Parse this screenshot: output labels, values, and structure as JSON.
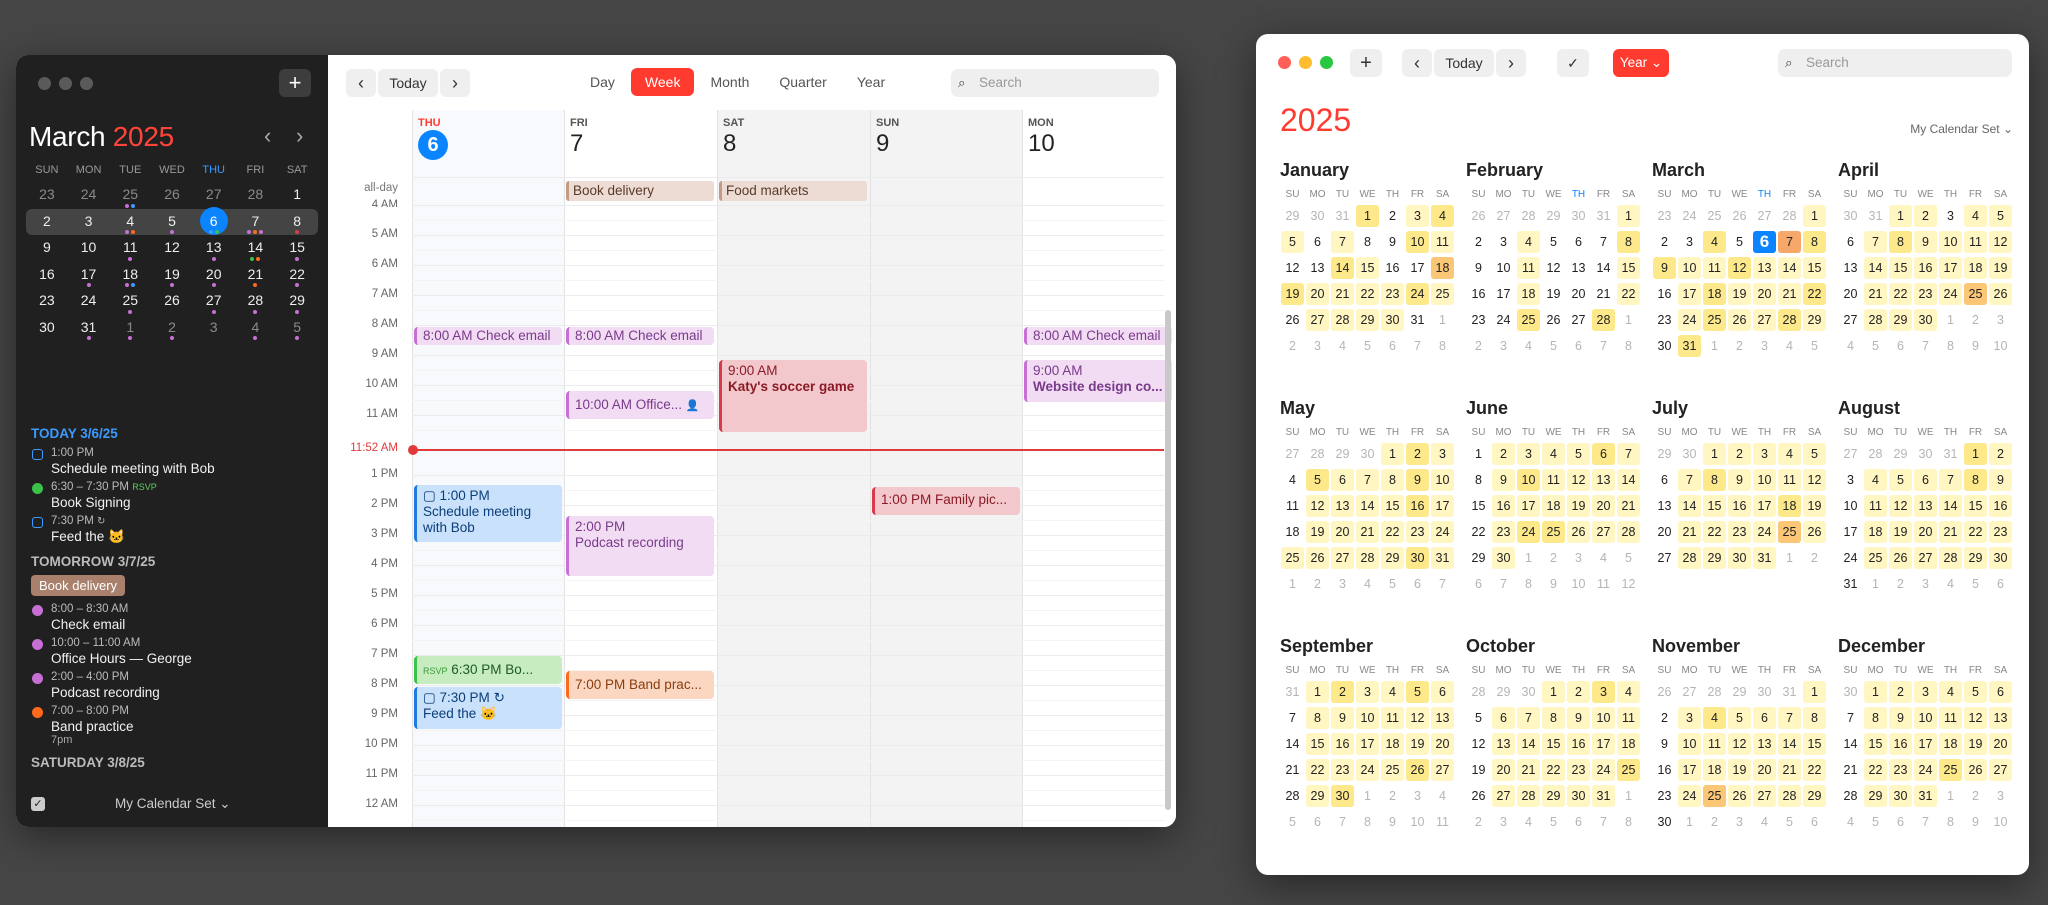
{
  "colors": {
    "accent_red": "#ff3b30",
    "today_blue": "#0a84ff"
  },
  "win1": {
    "add_label": "+",
    "mini": {
      "month": "March",
      "year": "2025",
      "prev": "‹",
      "next": "›",
      "weekdays": [
        "SUN",
        "MON",
        "TUE",
        "WED",
        "THU",
        "FRI",
        "SAT"
      ],
      "weeks": [
        [
          "23",
          "24",
          "25",
          "26",
          "27",
          "28",
          "1"
        ],
        [
          "2",
          "3",
          "4",
          "5",
          "6",
          "7",
          "8"
        ],
        [
          "9",
          "10",
          "11",
          "12",
          "13",
          "14",
          "15"
        ],
        [
          "16",
          "17",
          "18",
          "19",
          "20",
          "21",
          "22"
        ],
        [
          "23",
          "24",
          "25",
          "26",
          "27",
          "28",
          "29"
        ],
        [
          "30",
          "31",
          "1",
          "2",
          "3",
          "4",
          "5"
        ]
      ]
    },
    "agenda": {
      "today_head": "TODAY 3/6/25",
      "today_items": [
        {
          "time": "1:00 PM",
          "title": "Schedule meeting with Bob"
        },
        {
          "time": "6:30 – 7:30 PM",
          "rsvp": "RSVP",
          "title": "Book Signing"
        },
        {
          "time": "7:30 PM",
          "title": "Feed the 🐱"
        }
      ],
      "tomorrow_head": "TOMORROW 3/7/25",
      "tomorrow_allday": "Book delivery",
      "tomorrow_items": [
        {
          "time": "8:00 – 8:30 AM",
          "title": "Check email"
        },
        {
          "time": "10:00 – 11:00 AM",
          "title": "Office Hours — George"
        },
        {
          "time": "2:00 – 4:00 PM",
          "title": "Podcast recording"
        },
        {
          "time": "7:00 – 8:00 PM",
          "title": "Band practice",
          "sub": "7pm"
        }
      ],
      "saturday_head": "SATURDAY 3/8/25"
    },
    "bottom": {
      "calset": "My Calendar Set ⌄"
    },
    "toolbar": {
      "prev": "‹",
      "today": "Today",
      "next": "›",
      "views": [
        "Day",
        "Week",
        "Month",
        "Quarter",
        "Year"
      ],
      "search_placeholder": "Search"
    },
    "days": [
      {
        "name": "THU",
        "num": "6"
      },
      {
        "name": "FRI",
        "num": "7"
      },
      {
        "name": "SAT",
        "num": "8"
      },
      {
        "name": "SUN",
        "num": "9"
      },
      {
        "name": "MON",
        "num": "10"
      }
    ],
    "allday_label": "all-day",
    "allday_events": [
      "Book delivery",
      "Food markets"
    ],
    "hours": [
      "4 AM",
      "5 AM",
      "6 AM",
      "7 AM",
      "8 AM",
      "9 AM",
      "10 AM",
      "11 AM",
      "1 PM",
      "2 PM",
      "3 PM",
      "4 PM",
      "5 PM",
      "6 PM",
      "7 PM",
      "8 PM",
      "9 PM",
      "10 PM",
      "11 PM",
      "12 AM"
    ],
    "now_label": "11:52 AM",
    "events": {
      "thu_email": "8:00 AM Check email",
      "fri_email": "8:00 AM Check email",
      "mon_email": "8:00 AM Check email",
      "fri_office": "10:00 AM Office...",
      "sat_soccer_time": "9:00 AM",
      "sat_soccer_title": "Katy's soccer game",
      "mon_web_time": "9:00 AM",
      "mon_web_title": "Website design co...",
      "thu_bob_time": "1:00 PM",
      "thu_bob_title": "Schedule meeting with Bob",
      "sun_family": "1:00 PM Family pic...",
      "fri_pod_time": "2:00 PM",
      "fri_pod_title": "Podcast recording",
      "thu_book_rsvp": "RSVP",
      "thu_book": "6:30 PM Bo...",
      "fri_band": "7:00 PM Band prac...",
      "thu_feed_time": "7:30 PM",
      "thu_feed_title": "Feed the 🐱"
    }
  },
  "win2": {
    "toolbar": {
      "add": "+",
      "prev": "‹",
      "today": "Today",
      "next": "›",
      "check": "✓",
      "view": "Year ⌄",
      "search_placeholder": "Search"
    },
    "year": "2025",
    "calset": "My Calendar Set ⌄",
    "weekdays": [
      "SU",
      "MO",
      "TU",
      "WE",
      "TH",
      "FR",
      "SA"
    ],
    "months": [
      {
        "name": "January",
        "lead": [
          "29",
          "30",
          "31"
        ],
        "days": 31,
        "trail": [
          "1",
          "2",
          "3",
          "4",
          "5",
          "6",
          "7",
          "8"
        ],
        "hl": {
          "1": 2,
          "3": 1,
          "4": 2,
          "5": 1,
          "7": 1,
          "10": 2,
          "11": 1,
          "14": 2,
          "15": 1,
          "18": 3,
          "19": 2,
          "20": 1,
          "21": 1,
          "22": 1,
          "23": 1,
          "24": 2,
          "25": 1,
          "27": 1,
          "28": 1,
          "29": 1,
          "30": 1
        }
      },
      {
        "name": "February",
        "lead": [
          "26",
          "27",
          "28",
          "29",
          "30",
          "31"
        ],
        "days": 28,
        "trail": [
          "1",
          "2",
          "3",
          "4",
          "5",
          "6",
          "7",
          "8"
        ],
        "hl": {
          "1": 1,
          "4": 1,
          "8": 2,
          "11": 1,
          "15": 1,
          "18": 1,
          "22": 1,
          "25": 2,
          "28": 2
        }
      },
      {
        "name": "March",
        "lead": [
          "23",
          "24",
          "25",
          "26",
          "27",
          "28"
        ],
        "days": 31,
        "trail": [
          "1",
          "2",
          "3",
          "4",
          "5"
        ],
        "hl": {
          "1": 1,
          "4": 2,
          "6": 5,
          "7": 4,
          "8": 2,
          "9": 2,
          "10": 1,
          "11": 1,
          "12": 2,
          "13": 1,
          "14": 1,
          "15": 1,
          "17": 1,
          "18": 2,
          "19": 1,
          "20": 1,
          "21": 1,
          "22": 2,
          "24": 1,
          "25": 2,
          "26": 1,
          "27": 1,
          "28": 2,
          "29": 1,
          "31": 2
        }
      },
      {
        "name": "April",
        "lead": [
          "30",
          "31"
        ],
        "days": 30,
        "trail": [
          "1",
          "2",
          "3",
          "4",
          "5",
          "6",
          "7",
          "8",
          "9",
          "10"
        ],
        "hl": {
          "1": 1,
          "2": 1,
          "4": 1,
          "5": 1,
          "7": 1,
          "8": 2,
          "9": 1,
          "10": 1,
          "11": 1,
          "12": 1,
          "14": 1,
          "15": 1,
          "16": 1,
          "17": 1,
          "18": 1,
          "19": 1,
          "21": 1,
          "22": 1,
          "23": 1,
          "24": 1,
          "25": 3,
          "26": 1,
          "28": 1,
          "29": 1,
          "30": 1
        }
      },
      {
        "name": "May",
        "lead": [
          "27",
          "28",
          "29",
          "30"
        ],
        "days": 31,
        "trail": [
          "1",
          "2",
          "3",
          "4",
          "5",
          "6",
          "7"
        ],
        "hl": {
          "1": 1,
          "2": 2,
          "3": 1,
          "5": 2,
          "6": 1,
          "7": 1,
          "8": 1,
          "9": 2,
          "10": 1,
          "12": 1,
          "13": 1,
          "14": 1,
          "15": 1,
          "16": 2,
          "17": 1,
          "19": 1,
          "20": 1,
          "21": 1,
          "22": 1,
          "23": 1,
          "24": 1,
          "25": 1,
          "26": 1,
          "27": 1,
          "28": 1,
          "29": 1,
          "30": 2,
          "31": 1
        }
      },
      {
        "name": "June",
        "lead": [],
        "days": 30,
        "trail": [
          "1",
          "2",
          "3",
          "4",
          "5",
          "6",
          "7",
          "8",
          "9",
          "10",
          "11",
          "12"
        ],
        "hl": {
          "2": 1,
          "3": 1,
          "4": 1,
          "5": 1,
          "6": 2,
          "7": 1,
          "9": 1,
          "10": 2,
          "11": 1,
          "12": 1,
          "13": 1,
          "14": 1,
          "16": 1,
          "17": 1,
          "18": 1,
          "19": 1,
          "20": 1,
          "21": 1,
          "23": 1,
          "24": 2,
          "25": 2,
          "26": 1,
          "27": 1,
          "28": 1,
          "30": 1
        }
      },
      {
        "name": "July",
        "lead": [
          "29",
          "30"
        ],
        "days": 31,
        "trail": [
          "1",
          "2"
        ],
        "hl": {
          "1": 1,
          "2": 1,
          "3": 1,
          "4": 1,
          "5": 1,
          "7": 1,
          "8": 2,
          "9": 1,
          "10": 1,
          "11": 1,
          "12": 1,
          "14": 1,
          "15": 1,
          "16": 1,
          "17": 1,
          "18": 2,
          "19": 1,
          "21": 1,
          "22": 1,
          "23": 1,
          "24": 1,
          "25": 3,
          "26": 1,
          "28": 1,
          "29": 1,
          "30": 1,
          "31": 1
        }
      },
      {
        "name": "August",
        "lead": [
          "27",
          "28",
          "29",
          "30",
          "31"
        ],
        "days": 31,
        "trail": [
          "1",
          "2",
          "3",
          "4",
          "5",
          "6"
        ],
        "hl": {
          "1": 2,
          "2": 1,
          "4": 1,
          "5": 1,
          "6": 1,
          "7": 1,
          "8": 2,
          "9": 1,
          "11": 1,
          "12": 1,
          "13": 1,
          "14": 1,
          "15": 1,
          "16": 1,
          "18": 1,
          "19": 1,
          "20": 1,
          "21": 1,
          "22": 1,
          "23": 1,
          "25": 1,
          "26": 1,
          "27": 1,
          "28": 1,
          "29": 1,
          "30": 1
        }
      },
      {
        "name": "September",
        "lead": [
          "31"
        ],
        "days": 30,
        "trail": [
          "1",
          "2",
          "3",
          "4",
          "5",
          "6",
          "7",
          "8",
          "9",
          "10",
          "11"
        ],
        "hl": {
          "1": 1,
          "2": 2,
          "3": 1,
          "4": 1,
          "5": 2,
          "6": 1,
          "8": 1,
          "9": 1,
          "10": 1,
          "11": 1,
          "12": 1,
          "13": 1,
          "15": 1,
          "16": 1,
          "17": 1,
          "18": 1,
          "19": 1,
          "20": 1,
          "22": 1,
          "23": 1,
          "24": 1,
          "25": 1,
          "26": 2,
          "27": 1,
          "29": 1,
          "30": 2
        }
      },
      {
        "name": "October",
        "lead": [
          "28",
          "29",
          "30"
        ],
        "days": 31,
        "trail": [
          "1",
          "2",
          "3",
          "4",
          "5",
          "6",
          "7",
          "8"
        ],
        "hl": {
          "1": 1,
          "2": 1,
          "3": 2,
          "4": 1,
          "6": 1,
          "7": 1,
          "8": 1,
          "9": 1,
          "10": 1,
          "11": 1,
          "13": 1,
          "14": 1,
          "15": 1,
          "16": 1,
          "17": 1,
          "18": 1,
          "20": 1,
          "21": 1,
          "22": 1,
          "23": 1,
          "24": 1,
          "25": 2,
          "27": 1,
          "28": 1,
          "29": 1,
          "30": 1,
          "31": 1
        }
      },
      {
        "name": "November",
        "lead": [
          "26",
          "27",
          "28",
          "29",
          "30",
          "31"
        ],
        "days": 30,
        "trail": [
          "1",
          "2",
          "3",
          "4",
          "5",
          "6"
        ],
        "hl": {
          "1": 1,
          "3": 1,
          "4": 2,
          "5": 1,
          "6": 1,
          "7": 1,
          "8": 1,
          "10": 1,
          "11": 1,
          "12": 1,
          "13": 1,
          "14": 1,
          "15": 1,
          "17": 1,
          "18": 1,
          "19": 1,
          "20": 1,
          "21": 1,
          "22": 1,
          "24": 1,
          "25": 3,
          "26": 1,
          "27": 1,
          "28": 1,
          "29": 1
        }
      },
      {
        "name": "December",
        "lead": [
          "30"
        ],
        "days": 31,
        "trail": [
          "1",
          "2",
          "3",
          "4",
          "5",
          "6",
          "7",
          "8",
          "9",
          "10"
        ],
        "hl": {
          "1": 1,
          "2": 1,
          "3": 1,
          "4": 1,
          "5": 1,
          "6": 1,
          "8": 1,
          "9": 1,
          "10": 1,
          "11": 1,
          "12": 1,
          "13": 1,
          "15": 1,
          "16": 1,
          "17": 1,
          "18": 1,
          "19": 1,
          "20": 1,
          "22": 1,
          "23": 1,
          "24": 1,
          "25": 2,
          "26": 1,
          "27": 1,
          "29": 1,
          "30": 1,
          "31": 1
        }
      }
    ]
  }
}
